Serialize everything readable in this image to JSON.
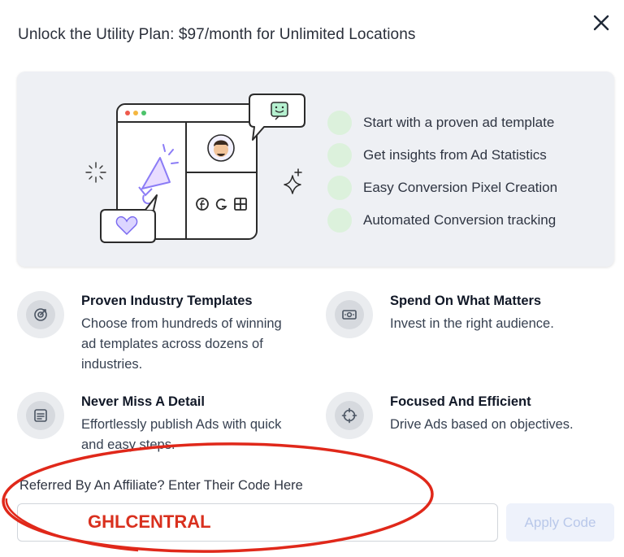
{
  "modal": {
    "title": "Unlock the Utility Plan: $97/month for Unlimited Locations",
    "close_icon": "close-icon"
  },
  "hero": {
    "checklist": [
      "Start with a proven ad template",
      "Get insights from Ad Statistics",
      "Easy Conversion Pixel Creation",
      "Automated Conversion tracking"
    ]
  },
  "features": [
    {
      "title": "Proven Industry Templates",
      "description": "Choose from hundreds of winning ad templates across dozens of industries.",
      "icon": "target-icon"
    },
    {
      "title": "Spend On What Matters",
      "description": "Invest in the right audience.",
      "icon": "money-icon"
    },
    {
      "title": "Never Miss A Detail",
      "description": "Effortlessly publish Ads with quick and easy steps.",
      "icon": "list-icon"
    },
    {
      "title": "Focused And Efficient",
      "description": "Drive Ads based on objectives.",
      "icon": "crosshair-icon"
    }
  ],
  "affiliate": {
    "label": "Referred By An Affiliate? Enter Their Code Here",
    "code_value": "GHLCENTRAL",
    "apply_label": "Apply Code"
  },
  "colors": {
    "accent_red": "#d9301e",
    "check_green": "#dcf1dc",
    "illustration_purple": "#8b7cf6",
    "apply_disabled": "#b9c8ea"
  }
}
